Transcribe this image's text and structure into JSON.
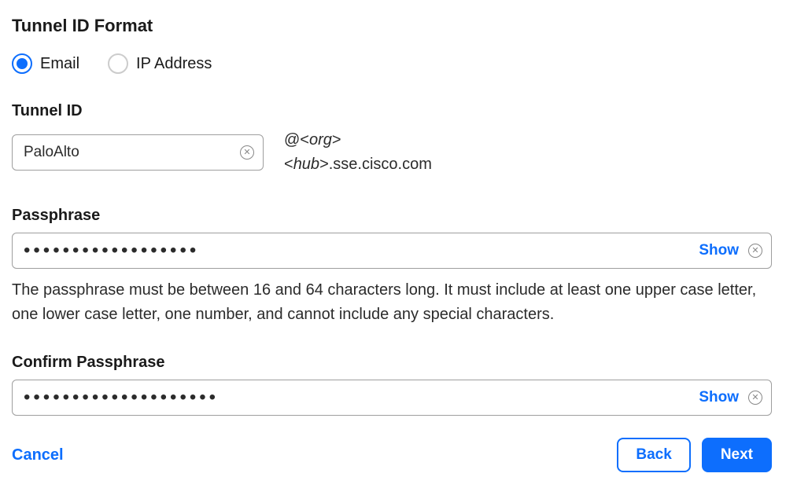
{
  "title": "Tunnel ID Format",
  "radios": {
    "email": "Email",
    "ip": "IP Address",
    "selected": "email"
  },
  "tunnel_id": {
    "label": "Tunnel ID",
    "value": "PaloAlto",
    "suffix_line1_prefix": "@<",
    "suffix_line1_em": "org",
    "suffix_line1_suffix": ">",
    "suffix_line2_prefix": "<",
    "suffix_line2_em": "hub",
    "suffix_line2_suffix": ">.sse.cisco.com"
  },
  "passphrase": {
    "label": "Passphrase",
    "value": "••••••••••••••••••",
    "show": "Show",
    "help": "The passphrase must be between 16 and 64 characters long. It must include at least one upper case letter, one lower case letter, one number, and cannot include any special characters."
  },
  "confirm": {
    "label": "Confirm Passphrase",
    "value": "••••••••••••••••••••",
    "show": "Show"
  },
  "footer": {
    "cancel": "Cancel",
    "back": "Back",
    "next": "Next"
  }
}
